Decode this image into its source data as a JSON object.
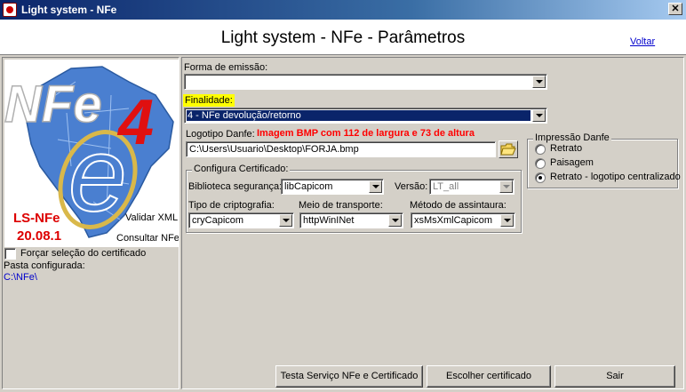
{
  "window": {
    "title": "Light system - NFe",
    "close_glyph": "✕"
  },
  "header": {
    "title": "Light system - NFe - Parâmetros",
    "back_link": "Voltar"
  },
  "left": {
    "logo_label": "LS-NFe",
    "logo_version": "20.08.1",
    "logo_big_text": "NFe",
    "logo_number": "4",
    "validate_xml": "Validar XML",
    "query_nfe": "Consultar NFe",
    "force_cert_label": "Forçar seleção do certificado",
    "folder_label": "Pasta configurada:",
    "folder_path": "C:\\NFe\\"
  },
  "form": {
    "emission_label": "Forma de emissão:",
    "emission_value": "",
    "finality_label": "Finalidade:",
    "finality_value": "4 - NFe devolução/retorno",
    "logo_label": "Logotipo Danfe:",
    "logo_hint": "Imagem BMP com 112 de largura e 73 de altura",
    "logo_path": "C:\\Users\\Usuario\\Desktop\\FORJA.bmp"
  },
  "print": {
    "legend": "Impressão Danfe",
    "options": [
      "Retrato",
      "Paisagem",
      "Retrato - logotipo centralizado"
    ],
    "selected": 2
  },
  "cert": {
    "legend": "Configura Certificado:",
    "lib_label": "Biblioteca segurança:",
    "lib_value": "libCapicom",
    "version_label": "Versão:",
    "version_value": "LT_all",
    "crypto_label": "Tipo de criptografia:",
    "crypto_value": "cryCapicom",
    "transport_label": "Meio de transporte:",
    "transport_value": "httpWinINet",
    "sign_label": "Método de assintaura:",
    "sign_value": "xsMsXmlCapicom"
  },
  "buttons": {
    "test": "Testa Serviço NFe e Certificado",
    "choose_cert": "Escolher certificado",
    "exit": "Sair"
  },
  "colors": {
    "highlight": "#ffff00",
    "hint_red": "#ff0000",
    "link_blue": "#0000cc",
    "selection": "#0a246a"
  }
}
